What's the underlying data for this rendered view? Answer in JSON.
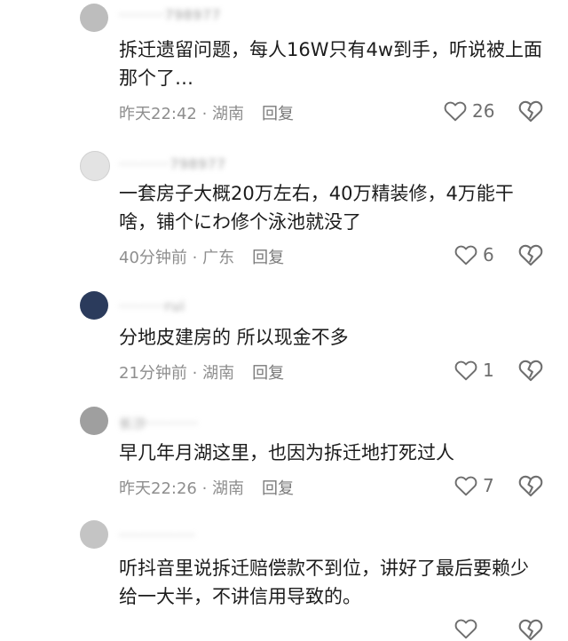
{
  "comments": [
    {
      "username": "·········798977",
      "text": "拆迁遗留问题，每人16W只有4w到手，听说被上面那个了…",
      "time": "昨天22:42",
      "location": "湖南",
      "reply": "回复",
      "likes": "26",
      "avatar_color": "#bdbdbd"
    },
    {
      "username": "··········798977",
      "text": "一套房子大概20万左右，40万精装修，4万能干啥，铺个にわ修个泳池就没了",
      "time": "40分钟前",
      "location": "广东",
      "reply": "回复",
      "likes": "6",
      "avatar_color": "#e3e3e3"
    },
    {
      "username": "·········rui",
      "text": "分地皮建房的 所以现金不多",
      "time": "21分钟前",
      "location": "湖南",
      "reply": "回复",
      "likes": "1",
      "avatar_color": "#2b3b5c"
    },
    {
      "username": "长沙··········",
      "text": "早几年月湖这里，也因为拆迁地打死过人",
      "time": "昨天22:26",
      "location": "湖南",
      "reply": "回复",
      "likes": "7",
      "avatar_color": "#9f9f9f"
    },
    {
      "username": "···············",
      "text": "听抖音里说拆迁赔偿款不到位，讲好了最后要赖少给一大半，不讲信用导致的。",
      "time": "",
      "location": "",
      "reply": "",
      "likes": "",
      "avatar_color": "#c4c4c4"
    }
  ],
  "icons": {
    "like": "heart-outline-icon",
    "dislike": "broken-heart-icon"
  },
  "separator": " · "
}
